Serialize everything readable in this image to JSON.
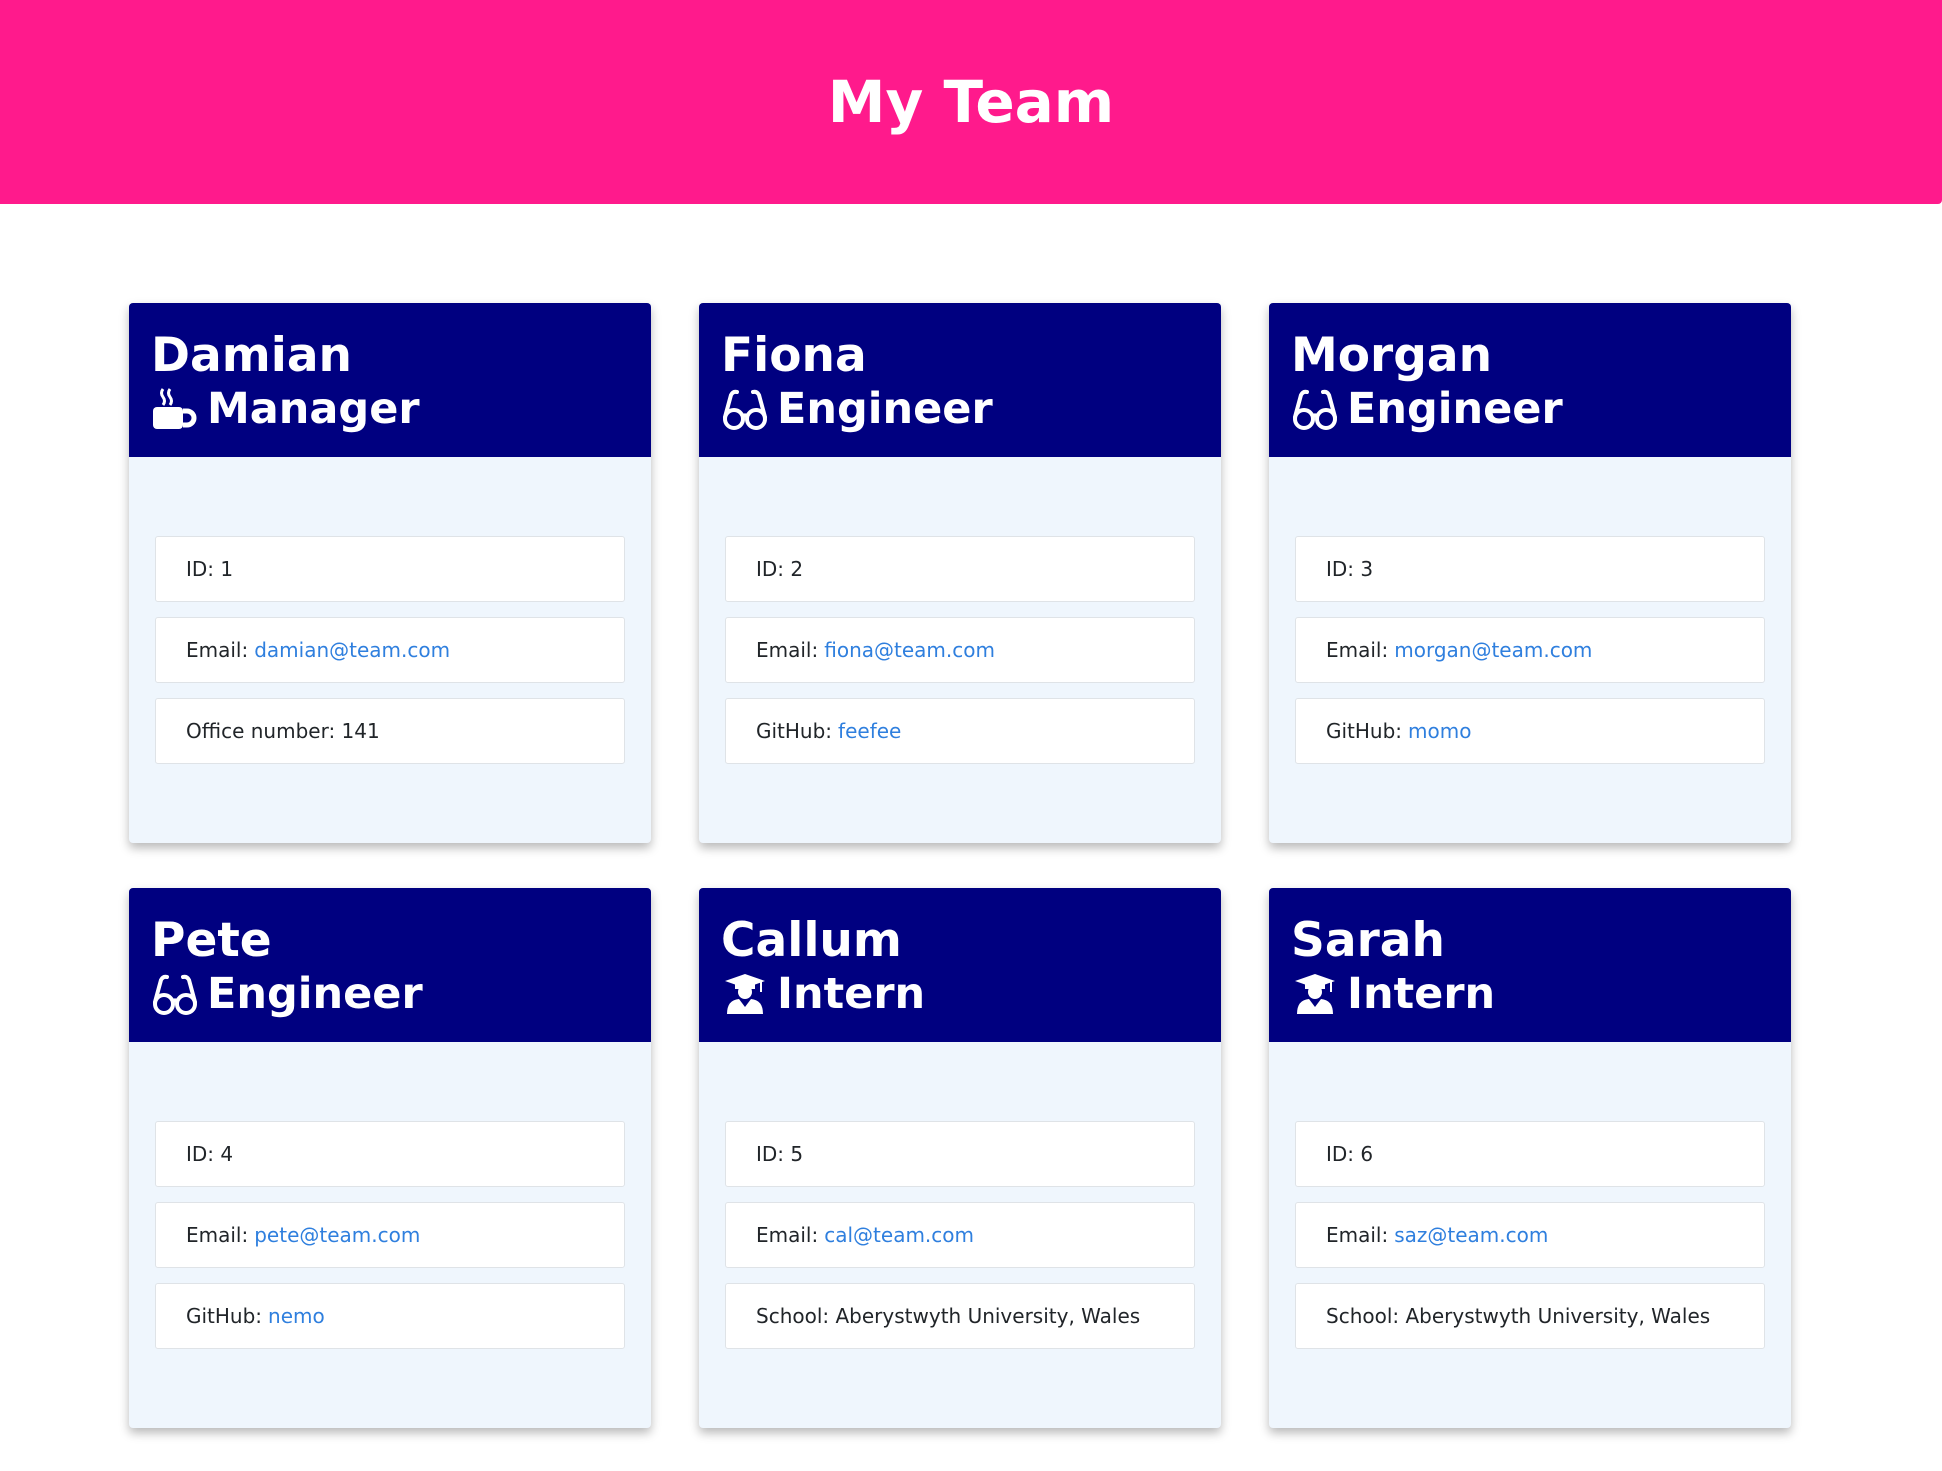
{
  "header": {
    "title": "My Team"
  },
  "colors": {
    "header_bg": "#ff1a8c",
    "card_head_bg": "#000080",
    "card_body_bg": "#eff6fd",
    "link": "#2f7fde"
  },
  "cards": [
    {
      "name": "Damian",
      "role": "Manager",
      "role_icon": "coffee-mug-icon",
      "id_label": "ID: 1",
      "email_label": "Email:",
      "email": "damian@team.com",
      "extra_label": "Office number: 141",
      "extra_link": ""
    },
    {
      "name": "Fiona",
      "role": "Engineer",
      "role_icon": "glasses-icon",
      "id_label": "ID: 2",
      "email_label": "Email:",
      "email": "fiona@team.com",
      "extra_label": "GitHub:",
      "extra_link": "feefee"
    },
    {
      "name": "Morgan",
      "role": "Engineer",
      "role_icon": "glasses-icon",
      "id_label": "ID: 3",
      "email_label": "Email:",
      "email": "morgan@team.com",
      "extra_label": "GitHub:",
      "extra_link": "momo"
    },
    {
      "name": "Pete",
      "role": "Engineer",
      "role_icon": "glasses-icon",
      "id_label": "ID: 4",
      "email_label": "Email:",
      "email": "pete@team.com",
      "extra_label": "GitHub:",
      "extra_link": "nemo"
    },
    {
      "name": "Callum",
      "role": "Intern",
      "role_icon": "graduate-icon",
      "id_label": "ID: 5",
      "email_label": "Email:",
      "email": "cal@team.com",
      "extra_label": "School: Aberystwyth University, Wales",
      "extra_link": ""
    },
    {
      "name": "Sarah",
      "role": "Intern",
      "role_icon": "graduate-icon",
      "id_label": "ID: 6",
      "email_label": "Email:",
      "email": "saz@team.com",
      "extra_label": "School: Aberystwyth University, Wales",
      "extra_link": ""
    }
  ]
}
